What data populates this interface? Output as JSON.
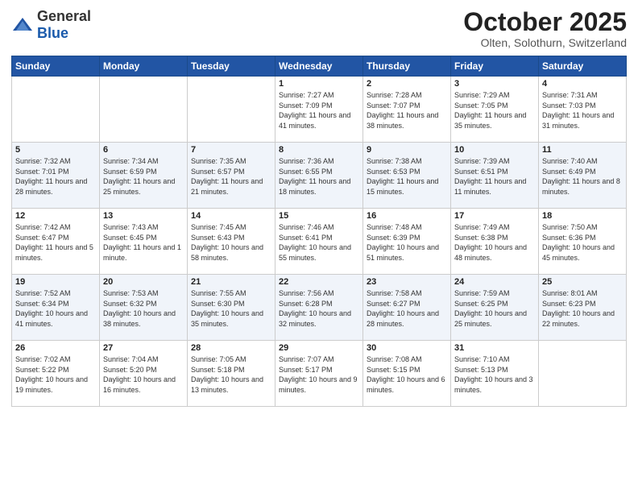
{
  "header": {
    "logo_general": "General",
    "logo_blue": "Blue",
    "month": "October 2025",
    "location": "Olten, Solothurn, Switzerland"
  },
  "weekdays": [
    "Sunday",
    "Monday",
    "Tuesday",
    "Wednesday",
    "Thursday",
    "Friday",
    "Saturday"
  ],
  "weeks": [
    [
      {
        "day": "",
        "info": ""
      },
      {
        "day": "",
        "info": ""
      },
      {
        "day": "",
        "info": ""
      },
      {
        "day": "1",
        "info": "Sunrise: 7:27 AM\nSunset: 7:09 PM\nDaylight: 11 hours\nand 41 minutes."
      },
      {
        "day": "2",
        "info": "Sunrise: 7:28 AM\nSunset: 7:07 PM\nDaylight: 11 hours\nand 38 minutes."
      },
      {
        "day": "3",
        "info": "Sunrise: 7:29 AM\nSunset: 7:05 PM\nDaylight: 11 hours\nand 35 minutes."
      },
      {
        "day": "4",
        "info": "Sunrise: 7:31 AM\nSunset: 7:03 PM\nDaylight: 11 hours\nand 31 minutes."
      }
    ],
    [
      {
        "day": "5",
        "info": "Sunrise: 7:32 AM\nSunset: 7:01 PM\nDaylight: 11 hours\nand 28 minutes."
      },
      {
        "day": "6",
        "info": "Sunrise: 7:34 AM\nSunset: 6:59 PM\nDaylight: 11 hours\nand 25 minutes."
      },
      {
        "day": "7",
        "info": "Sunrise: 7:35 AM\nSunset: 6:57 PM\nDaylight: 11 hours\nand 21 minutes."
      },
      {
        "day": "8",
        "info": "Sunrise: 7:36 AM\nSunset: 6:55 PM\nDaylight: 11 hours\nand 18 minutes."
      },
      {
        "day": "9",
        "info": "Sunrise: 7:38 AM\nSunset: 6:53 PM\nDaylight: 11 hours\nand 15 minutes."
      },
      {
        "day": "10",
        "info": "Sunrise: 7:39 AM\nSunset: 6:51 PM\nDaylight: 11 hours\nand 11 minutes."
      },
      {
        "day": "11",
        "info": "Sunrise: 7:40 AM\nSunset: 6:49 PM\nDaylight: 11 hours\nand 8 minutes."
      }
    ],
    [
      {
        "day": "12",
        "info": "Sunrise: 7:42 AM\nSunset: 6:47 PM\nDaylight: 11 hours\nand 5 minutes."
      },
      {
        "day": "13",
        "info": "Sunrise: 7:43 AM\nSunset: 6:45 PM\nDaylight: 11 hours\nand 1 minute."
      },
      {
        "day": "14",
        "info": "Sunrise: 7:45 AM\nSunset: 6:43 PM\nDaylight: 10 hours\nand 58 minutes."
      },
      {
        "day": "15",
        "info": "Sunrise: 7:46 AM\nSunset: 6:41 PM\nDaylight: 10 hours\nand 55 minutes."
      },
      {
        "day": "16",
        "info": "Sunrise: 7:48 AM\nSunset: 6:39 PM\nDaylight: 10 hours\nand 51 minutes."
      },
      {
        "day": "17",
        "info": "Sunrise: 7:49 AM\nSunset: 6:38 PM\nDaylight: 10 hours\nand 48 minutes."
      },
      {
        "day": "18",
        "info": "Sunrise: 7:50 AM\nSunset: 6:36 PM\nDaylight: 10 hours\nand 45 minutes."
      }
    ],
    [
      {
        "day": "19",
        "info": "Sunrise: 7:52 AM\nSunset: 6:34 PM\nDaylight: 10 hours\nand 41 minutes."
      },
      {
        "day": "20",
        "info": "Sunrise: 7:53 AM\nSunset: 6:32 PM\nDaylight: 10 hours\nand 38 minutes."
      },
      {
        "day": "21",
        "info": "Sunrise: 7:55 AM\nSunset: 6:30 PM\nDaylight: 10 hours\nand 35 minutes."
      },
      {
        "day": "22",
        "info": "Sunrise: 7:56 AM\nSunset: 6:28 PM\nDaylight: 10 hours\nand 32 minutes."
      },
      {
        "day": "23",
        "info": "Sunrise: 7:58 AM\nSunset: 6:27 PM\nDaylight: 10 hours\nand 28 minutes."
      },
      {
        "day": "24",
        "info": "Sunrise: 7:59 AM\nSunset: 6:25 PM\nDaylight: 10 hours\nand 25 minutes."
      },
      {
        "day": "25",
        "info": "Sunrise: 8:01 AM\nSunset: 6:23 PM\nDaylight: 10 hours\nand 22 minutes."
      }
    ],
    [
      {
        "day": "26",
        "info": "Sunrise: 7:02 AM\nSunset: 5:22 PM\nDaylight: 10 hours\nand 19 minutes."
      },
      {
        "day": "27",
        "info": "Sunrise: 7:04 AM\nSunset: 5:20 PM\nDaylight: 10 hours\nand 16 minutes."
      },
      {
        "day": "28",
        "info": "Sunrise: 7:05 AM\nSunset: 5:18 PM\nDaylight: 10 hours\nand 13 minutes."
      },
      {
        "day": "29",
        "info": "Sunrise: 7:07 AM\nSunset: 5:17 PM\nDaylight: 10 hours\nand 9 minutes."
      },
      {
        "day": "30",
        "info": "Sunrise: 7:08 AM\nSunset: 5:15 PM\nDaylight: 10 hours\nand 6 minutes."
      },
      {
        "day": "31",
        "info": "Sunrise: 7:10 AM\nSunset: 5:13 PM\nDaylight: 10 hours\nand 3 minutes."
      },
      {
        "day": "",
        "info": ""
      }
    ]
  ]
}
